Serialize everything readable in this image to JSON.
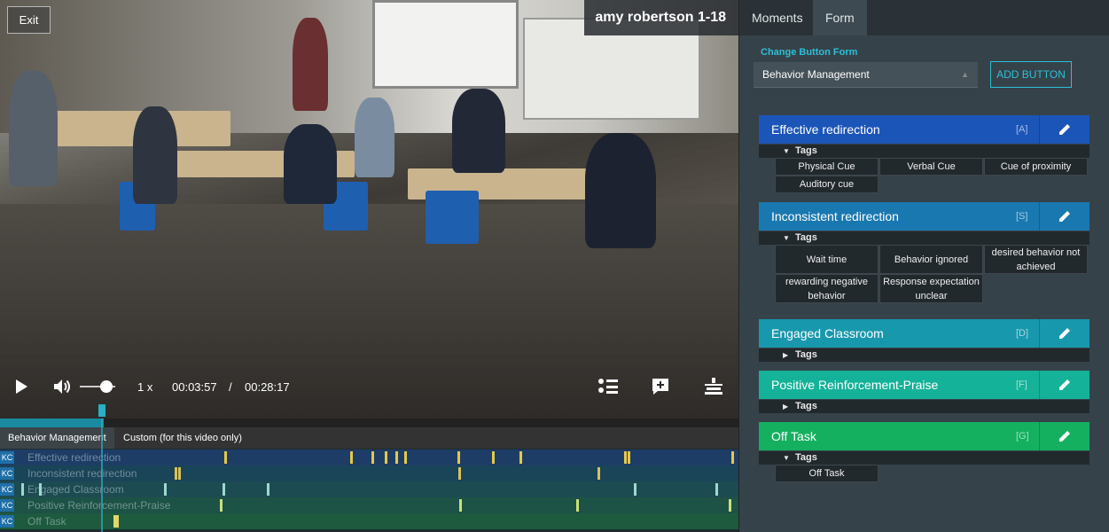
{
  "video": {
    "exit_label": "Exit",
    "title": "amy robertson 1-18",
    "speed": "1 x",
    "time_current": "00:03:57",
    "time_separator": "/",
    "time_total": "00:28:17",
    "volume_level": 0.6,
    "progress": 0.14
  },
  "timeline": {
    "tabs": [
      "Behavior Management",
      "Custom (for this video only)"
    ],
    "kc_label": "KC",
    "tracks": [
      {
        "label": "Effective redirection",
        "color": "#1e3d66",
        "marker_color": "#e5c84a"
      },
      {
        "label": "Inconsistent redirection",
        "color": "#1a4458",
        "marker_color": "#d9c25a"
      },
      {
        "label": "Engaged Classroom",
        "color": "#1d4b52",
        "marker_color": "#9ed8cf"
      },
      {
        "label": "Positive Reinforcement-Praise",
        "color": "#1d5246",
        "marker_color": "#c8e07a"
      },
      {
        "label": "Off Task",
        "color": "#1d5a3e",
        "marker_color": "#e0d86a"
      }
    ]
  },
  "sidebar": {
    "tabs": [
      "Moments",
      "Form"
    ],
    "active_tab": "Form",
    "change_form_label": "Change Button Form",
    "form_select_value": "Behavior Management",
    "add_button_label": "ADD BUTTON",
    "tags_label": "Tags",
    "behaviors": [
      {
        "name": "Effective redirection",
        "key": "[A]",
        "color": "#1b55b8",
        "tags": [
          "Physical Cue",
          "Verbal Cue",
          "Cue of proximity",
          "Auditory cue"
        ]
      },
      {
        "name": "Inconsistent redirection",
        "key": "[S]",
        "color": "#1a78b0",
        "tags": [
          "Wait time",
          "Behavior ignored",
          "desired behavior not achieved",
          "rewarding negative behavior",
          "Response expectation unclear"
        ]
      },
      {
        "name": "Engaged Classroom",
        "key": "[D]",
        "color": "#1898ad",
        "tags": []
      },
      {
        "name": "Positive Reinforcement-Praise",
        "key": "[F]",
        "color": "#14b298",
        "tags": []
      },
      {
        "name": "Off Task",
        "key": "[G]",
        "color": "#14b060",
        "tags": [
          "Off Task"
        ]
      }
    ]
  }
}
